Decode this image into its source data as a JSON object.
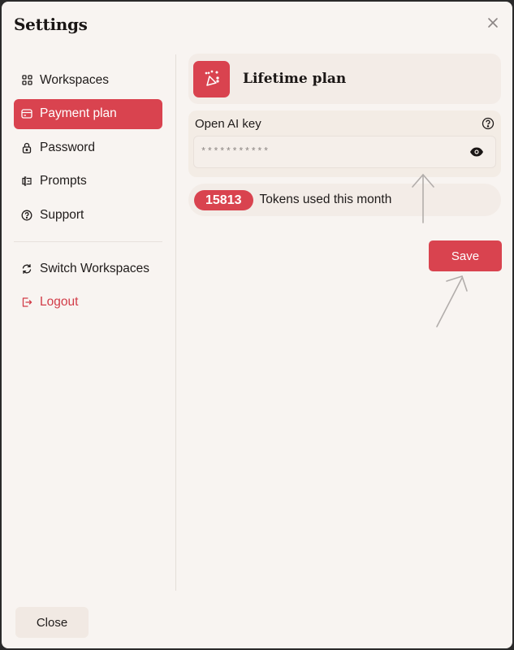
{
  "dialog": {
    "title": "Settings",
    "close_icon": "close-icon"
  },
  "sidebar": {
    "items": [
      {
        "label": "Workspaces",
        "icon": "grid-icon",
        "active": false
      },
      {
        "label": "Payment plan",
        "icon": "credit-card-icon",
        "active": true
      },
      {
        "label": "Password",
        "icon": "lock-icon",
        "active": false
      },
      {
        "label": "Prompts",
        "icon": "text-cursor-icon",
        "active": false
      },
      {
        "label": "Support",
        "icon": "help-circle-icon",
        "active": false
      }
    ],
    "secondary_items": [
      {
        "label": "Switch Workspaces",
        "icon": "refresh-icon"
      },
      {
        "label": "Logout",
        "icon": "logout-icon"
      }
    ]
  },
  "main": {
    "plan": {
      "title": "Lifetime plan",
      "icon": "party-popper-icon"
    },
    "openai_key": {
      "label": "Open AI key",
      "value": "***********",
      "help_icon": "help-circle-icon",
      "reveal_icon": "eye-icon"
    },
    "tokens": {
      "count": "15813",
      "label": "Tokens used this month"
    },
    "save_label": "Save"
  },
  "footer": {
    "close_label": "Close"
  },
  "colors": {
    "accent": "#d9434f",
    "background": "#f8f4f1",
    "card": "#f3ece7"
  }
}
